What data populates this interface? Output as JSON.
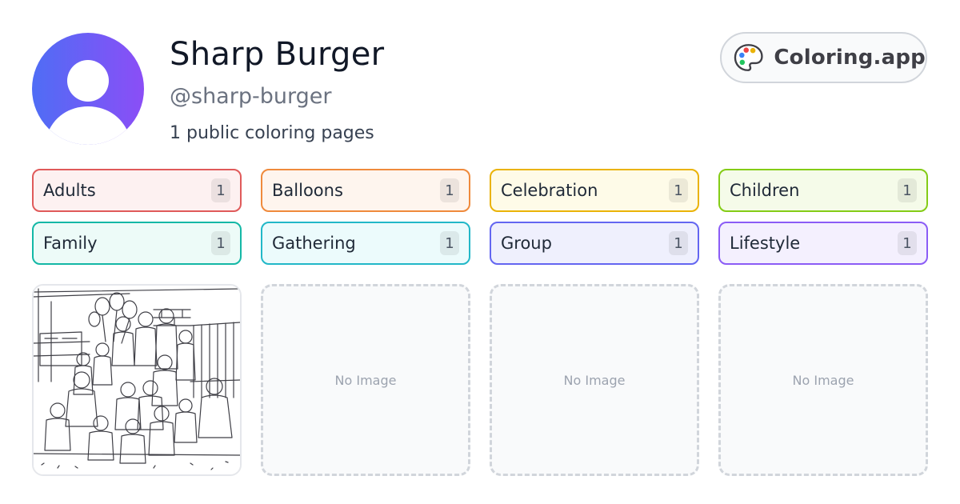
{
  "profile": {
    "name": "Sharp Burger",
    "handle": "@sharp-burger",
    "page_count_text": "1 public coloring pages",
    "avatar_gradient": [
      "#4f6df5",
      "#8b4ef6"
    ]
  },
  "brand": {
    "label": "Coloring.app",
    "icon": "palette-icon"
  },
  "tags": [
    {
      "label": "Adults",
      "count": "1",
      "border": "#e05a5a",
      "bg": "#fdf1f1"
    },
    {
      "label": "Balloons",
      "count": "1",
      "border": "#ef8a3c",
      "bg": "#fef5ee"
    },
    {
      "label": "Celebration",
      "count": "1",
      "border": "#eab308",
      "bg": "#fefbe8"
    },
    {
      "label": "Children",
      "count": "1",
      "border": "#84cc16",
      "bg": "#f5fbe9"
    },
    {
      "label": "Family",
      "count": "1",
      "border": "#14b8a6",
      "bg": "#edfbf8"
    },
    {
      "label": "Gathering",
      "count": "1",
      "border": "#22b8c8",
      "bg": "#ecfbfc"
    },
    {
      "label": "Group",
      "count": "1",
      "border": "#6366f1",
      "bg": "#eff0fd"
    },
    {
      "label": "Lifestyle",
      "count": "1",
      "border": "#8b5cf6",
      "bg": "#f4f0fe"
    }
  ],
  "thumbnails": [
    {
      "type": "image",
      "alt": ""
    },
    {
      "type": "empty",
      "text": "No Image"
    },
    {
      "type": "empty",
      "text": "No Image"
    },
    {
      "type": "empty",
      "text": "No Image"
    }
  ]
}
